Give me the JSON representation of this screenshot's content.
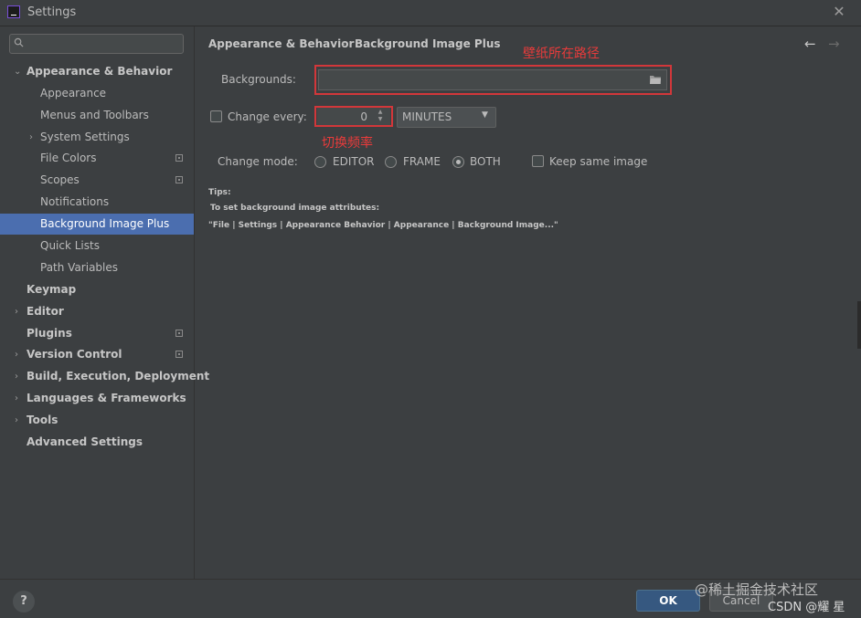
{
  "window": {
    "title": "Settings",
    "close_glyph": "✕"
  },
  "search": {
    "placeholder": "",
    "icon": "search-icon"
  },
  "sidebar": {
    "items": [
      {
        "label": "Appearance & Behavior",
        "expanded": true
      },
      {
        "label": "Appearance"
      },
      {
        "label": "Menus and Toolbars"
      },
      {
        "label": "System Settings"
      },
      {
        "label": "File Colors"
      },
      {
        "label": "Scopes"
      },
      {
        "label": "Notifications"
      },
      {
        "label": "Background Image Plus",
        "selected": true
      },
      {
        "label": "Quick Lists"
      },
      {
        "label": "Path Variables"
      },
      {
        "label": "Keymap"
      },
      {
        "label": "Editor"
      },
      {
        "label": "Plugins"
      },
      {
        "label": "Version Control"
      },
      {
        "label": "Build, Execution, Deployment"
      },
      {
        "label": "Languages & Frameworks"
      },
      {
        "label": "Tools"
      },
      {
        "label": "Advanced Settings"
      }
    ]
  },
  "breadcrumb": {
    "parent": "Appearance & Behavior",
    "separator": "›",
    "current": "Background Image Plus"
  },
  "nav": {
    "back": "←",
    "forward": "→"
  },
  "form": {
    "backgrounds_label": "Backgrounds:",
    "backgrounds_value": "",
    "change_every_label": "Change every:",
    "change_every_checked": false,
    "interval_value": "0",
    "unit_value": "MINUTES",
    "change_mode_label": "Change mode:",
    "modes": [
      "EDITOR",
      "FRAME",
      "BOTH"
    ],
    "mode_selected": "BOTH",
    "keep_same_label": "Keep same image",
    "keep_same_checked": false
  },
  "tips": {
    "title": "Tips:",
    "line1": "To set background image attributes:",
    "line2": "\"File | Settings | Appearance  Behavior | Appearance | Background Image...\""
  },
  "annotations": {
    "path_note": "壁纸所在路径",
    "frequency_note": "切换频率"
  },
  "footer": {
    "help": "?",
    "ok": "OK",
    "cancel": "Cancel"
  },
  "watermark": {
    "line1": "@稀土掘金技术社区",
    "line2": "CSDN @耀 星"
  },
  "colors": {
    "selection": "#4b6eaf",
    "annotation": "#e83b3b",
    "ok_button": "#365880",
    "background": "#3c3f41"
  }
}
